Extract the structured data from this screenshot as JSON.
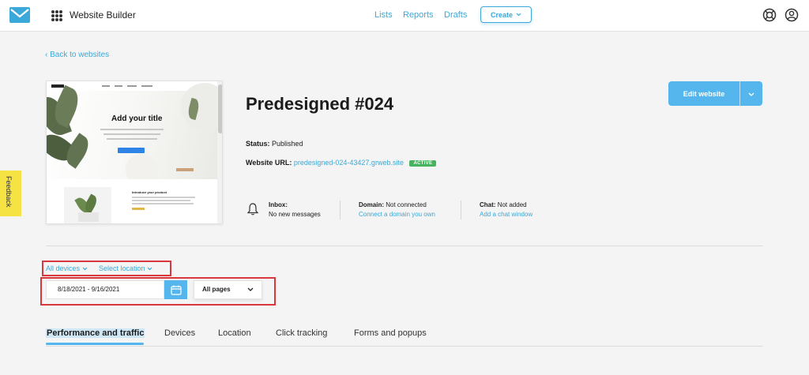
{
  "header": {
    "app_title": "Website Builder",
    "nav": [
      "Lists",
      "Reports",
      "Drafts"
    ],
    "create_label": "Create",
    "icons": [
      "mail-logo-icon",
      "apps-grid-icon",
      "help-lifebuoy-icon",
      "account-icon"
    ],
    "accent_color": "#3aa8d8"
  },
  "feedback_label": "Feedback",
  "back_link": "Back to websites",
  "thumbnail": {
    "hero_title": "Add your title",
    "section_title": "Introduce your product"
  },
  "site": {
    "title": "Predesigned #024",
    "status_label": "Status:",
    "status_value": "Published",
    "url_label": "Website URL:",
    "url_value": "predesigned-024-43427.grweb.site",
    "url_badge": "ACTIVE",
    "badge_color": "#47b35f"
  },
  "edit_button": {
    "label": "Edit website"
  },
  "info": {
    "inbox_label": "Inbox:",
    "inbox_value": "No new messages",
    "domain_label": "Domain:",
    "domain_value": "Not connected",
    "domain_link": "Connect a domain you own",
    "chat_label": "Chat:",
    "chat_value": "Not added",
    "chat_link": "Add a chat window"
  },
  "filters": {
    "devices": "All devices",
    "location": "Select location",
    "date_range": "8/18/2021 - 9/16/2021",
    "pages": "All pages"
  },
  "tabs": [
    "Performance and traffic",
    "Devices",
    "Location",
    "Click tracking",
    "Forms and popups"
  ],
  "active_tab": "Performance and traffic"
}
